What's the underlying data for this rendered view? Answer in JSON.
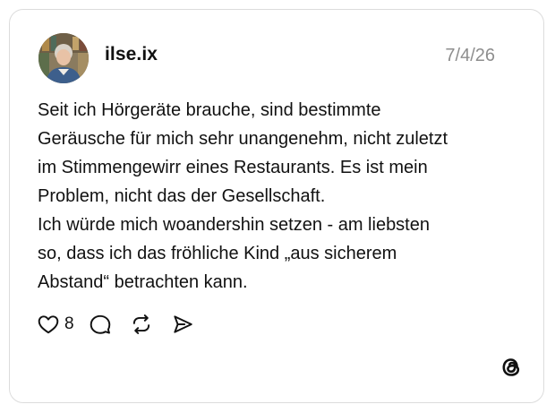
{
  "post": {
    "username": "ilse.ix",
    "date": "7/4/26",
    "text_lines": [
      "Seit ich Hörgeräte brauche, sind bestimmte",
      "Geräusche für mich sehr unangenehm, nicht zuletzt",
      "im Stimmengewirr eines Restaurants. Es ist mein",
      "Problem, nicht das der Gesellschaft.",
      "Ich würde mich woandershin setzen - am liebsten",
      "so, dass ich das fröhliche Kind „aus sicherem",
      "Abstand“ betrachten kann."
    ],
    "like_count": "8"
  },
  "icons": {
    "like": "heart-icon",
    "comment": "comment-bubble-icon",
    "repost": "repost-icon",
    "share": "send-icon",
    "brand": "threads-logo-icon"
  },
  "colors": {
    "text": "#111111",
    "muted": "#8e8e8e",
    "border": "#dcdcdc",
    "background": "#ffffff"
  }
}
